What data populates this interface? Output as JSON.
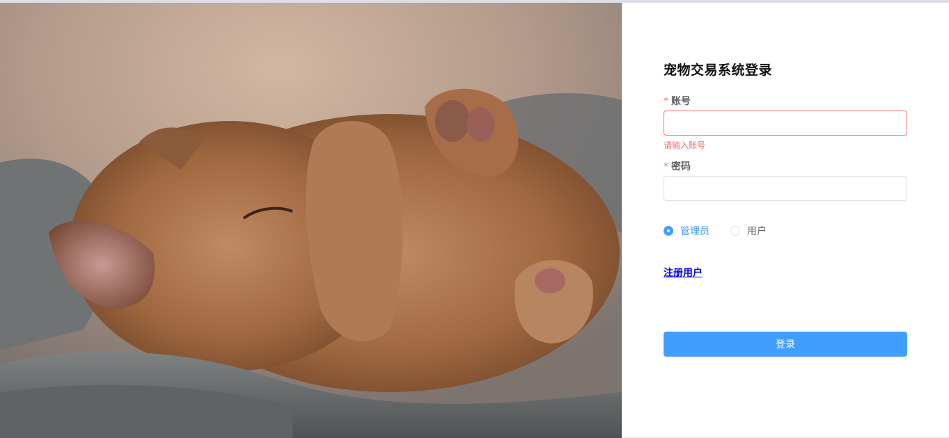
{
  "login": {
    "title": "宠物交易系统登录",
    "account": {
      "required_mark": "*",
      "label": "账号",
      "value": "",
      "error": "请输入账号"
    },
    "password": {
      "required_mark": "*",
      "label": "密码",
      "value": ""
    },
    "roles": [
      {
        "label": "管理员",
        "checked": true
      },
      {
        "label": "用户",
        "checked": false
      }
    ],
    "register_link": "注册用户",
    "submit_label": "登录"
  },
  "hero": {
    "subject": "kitten",
    "colors": {
      "fur": "#a8724e",
      "fur_dark": "#6e4328",
      "blanket": "#6b6f70",
      "background": "#c4a995"
    }
  },
  "colors": {
    "primary": "#409eff",
    "error": "#f56c6c",
    "link": "#0000ee",
    "border": "#dcdfe6"
  }
}
